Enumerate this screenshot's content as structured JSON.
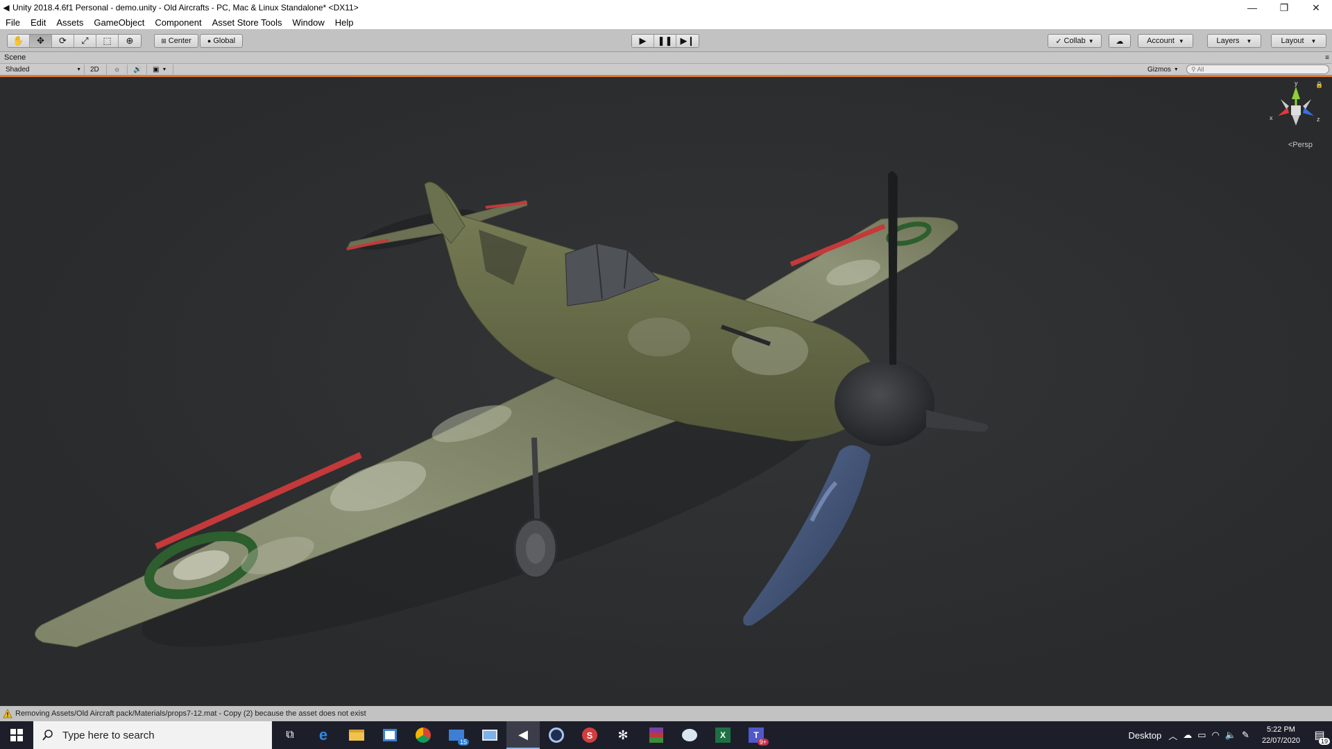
{
  "window": {
    "title": "Unity 2018.4.6f1 Personal - demo.unity - Old Aircrafts - PC, Mac & Linux Standalone* <DX11>",
    "app_icon": "unity-icon",
    "controls": [
      "minimize",
      "restore",
      "close"
    ]
  },
  "menu": [
    "File",
    "Edit",
    "Assets",
    "GameObject",
    "Component",
    "Asset Store Tools",
    "Window",
    "Help"
  ],
  "toolbar": {
    "tools": [
      "hand-tool-icon",
      "move-tool-icon",
      "rotate-tool-icon",
      "scale-tool-icon",
      "rect-tool-icon",
      "transform-tool-icon"
    ],
    "active_tool": "move-tool-icon",
    "pivot_label": "Center",
    "space_label": "Global",
    "play": [
      "play-icon",
      "pause-icon",
      "step-icon"
    ],
    "collab_label": "Collab",
    "account_label": "Account",
    "layers_label": "Layers",
    "layout_label": "Layout"
  },
  "scene": {
    "tab_label": "Scene",
    "shading_mode": "Shaded",
    "mode_2d": "2D",
    "gizmos_label": "Gizmos",
    "search_placeholder": "All",
    "gizmo_axes": {
      "y": "y",
      "x": "x",
      "z": "z"
    },
    "projection": "Persp"
  },
  "status": {
    "message": "Removing Assets/Old Aircraft pack/Materials/props7-12.mat - Copy (2) because the asset does not exist"
  },
  "taskbar": {
    "search_placeholder": "Type here to search",
    "apps": [
      {
        "name": "task-view-icon",
        "badge": ""
      },
      {
        "name": "edge-icon",
        "badge": ""
      },
      {
        "name": "file-explorer-icon",
        "badge": ""
      },
      {
        "name": "store-icon",
        "badge": ""
      },
      {
        "name": "chrome-icon",
        "badge": ""
      },
      {
        "name": "mail-icon",
        "badge": "15"
      },
      {
        "name": "remote-desktop-icon",
        "badge": ""
      },
      {
        "name": "unity-icon",
        "badge": ""
      },
      {
        "name": "cinema4d-icon",
        "badge": ""
      },
      {
        "name": "substance-icon",
        "badge": ""
      },
      {
        "name": "slack-icon",
        "badge": ""
      },
      {
        "name": "winrar-icon",
        "badge": ""
      },
      {
        "name": "paint-icon",
        "badge": ""
      },
      {
        "name": "excel-icon",
        "badge": ""
      },
      {
        "name": "teams-icon",
        "badge": "9+"
      }
    ],
    "active_app": "unity-icon",
    "desktop_label": "Desktop",
    "time": "5:22 PM",
    "date": "22/07/2020",
    "notification_count": "19"
  }
}
